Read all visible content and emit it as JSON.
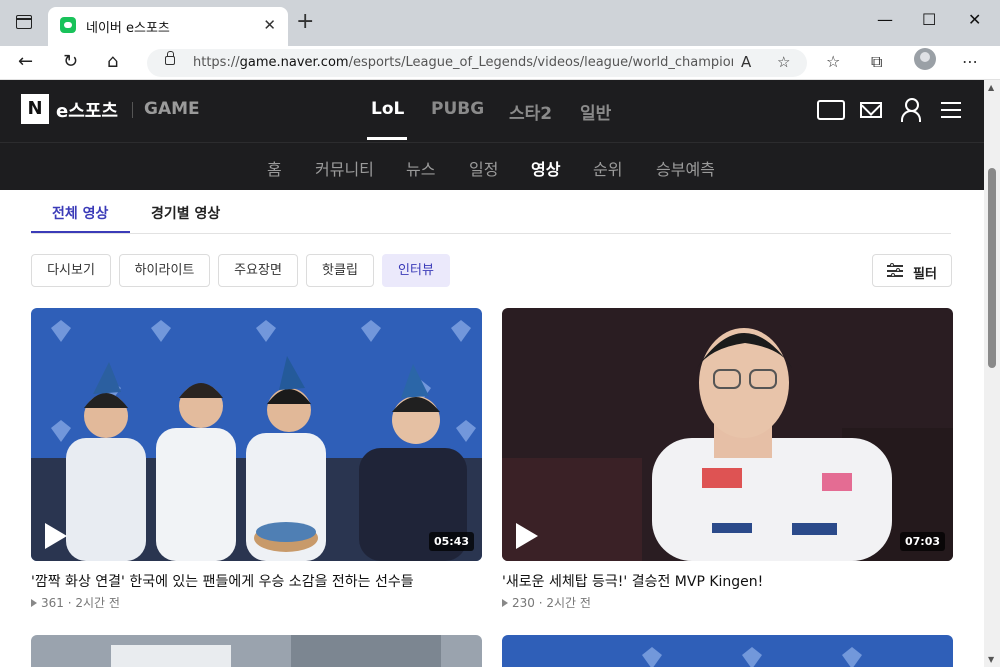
{
  "browser": {
    "tab_title": "네이버 e스포츠",
    "tab_close": "✕",
    "new_tab": "+",
    "url_host": "game.naver.com",
    "url_prefix": "https://",
    "url_path": "/esports/League_of_Legends/videos/league/world_champion...",
    "window_controls": [
      "—",
      "☐",
      "✕"
    ]
  },
  "site": {
    "logo_mark": "N",
    "logo_text": "e스포츠",
    "logo_game": "GAME",
    "game_tabs": [
      "LoL",
      "PUBG",
      "스타2",
      "일반"
    ],
    "active_game_tab": "LoL",
    "sub_nav": [
      "홈",
      "커뮤니티",
      "뉴스",
      "일정",
      "영상",
      "순위",
      "승부예측"
    ],
    "active_sub_nav": "영상"
  },
  "content_tabs": [
    "전체 영상",
    "경기별 영상"
  ],
  "active_content_tab": "전체 영상",
  "chips": [
    "다시보기",
    "하이라이트",
    "주요장면",
    "핫클립",
    "인터뷰"
  ],
  "active_chip": "인터뷰",
  "filter_label": "필터",
  "videos": [
    {
      "title": "'깜짝 화상 연결' 한국에 있는 팬들에게 우승 소감을 전하는 선수들",
      "views": "361",
      "time": "2시간 전",
      "duration": "05:43"
    },
    {
      "title": "'새로운 세체탑 등극!' 결승전 MVP Kingen!",
      "views": "230",
      "time": "2시간 전",
      "duration": "07:03"
    }
  ],
  "colors": {
    "accent": "#3b3bb8",
    "header_bg": "#1d1d1f",
    "chip_active_bg": "#ebe9fb"
  }
}
